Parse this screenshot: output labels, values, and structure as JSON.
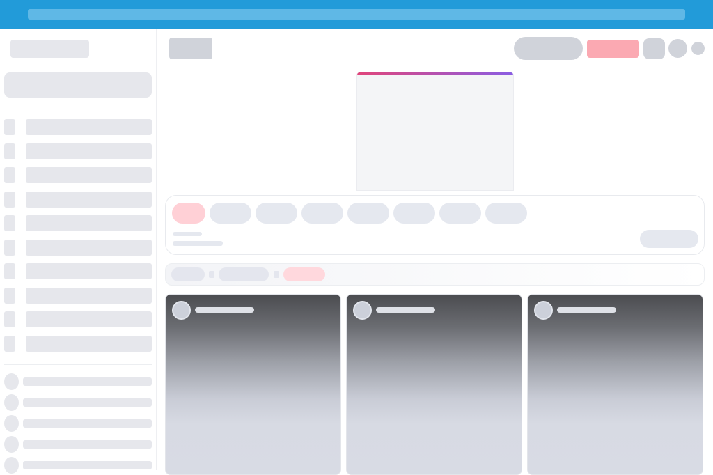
{
  "browser": {
    "url": ""
  },
  "sidebar": {
    "logo": "",
    "search_placeholder": "",
    "nav_items": [
      {
        "label": "",
        "icon": "nav-icon"
      },
      {
        "label": "",
        "icon": "nav-icon"
      },
      {
        "label": "",
        "icon": "nav-icon"
      },
      {
        "label": "",
        "icon": "nav-icon"
      },
      {
        "label": "",
        "icon": "nav-icon"
      },
      {
        "label": "",
        "icon": "nav-icon"
      },
      {
        "label": "",
        "icon": "nav-icon"
      },
      {
        "label": "",
        "icon": "nav-icon"
      },
      {
        "label": "",
        "icon": "nav-icon"
      },
      {
        "label": "",
        "icon": "nav-icon"
      }
    ],
    "subscriptions": [
      {
        "label": ""
      },
      {
        "label": ""
      },
      {
        "label": ""
      },
      {
        "label": ""
      },
      {
        "label": ""
      }
    ]
  },
  "topbar": {
    "title": "",
    "search_placeholder": "",
    "cta_label": "",
    "icons": [
      "apps-icon",
      "notifications-icon",
      "profile-avatar"
    ]
  },
  "ad": {
    "label": ""
  },
  "filters": {
    "chips": [
      "",
      "",
      "",
      "",
      "",
      "",
      "",
      ""
    ],
    "active_index": 0,
    "meta_line1": "",
    "meta_line2": "",
    "action_label": ""
  },
  "breadcrumbs": [
    "",
    "",
    ""
  ],
  "cards": [
    {
      "author": ""
    },
    {
      "author": ""
    },
    {
      "author": ""
    }
  ],
  "colors": {
    "browser_bar": "#229bd9",
    "accent_pink": "#fba9b2",
    "active_chip": "#ffd0d6",
    "skeleton": "#e6e7ec",
    "ad_accent_start": "#e0457b",
    "ad_accent_end": "#8a5de3"
  }
}
